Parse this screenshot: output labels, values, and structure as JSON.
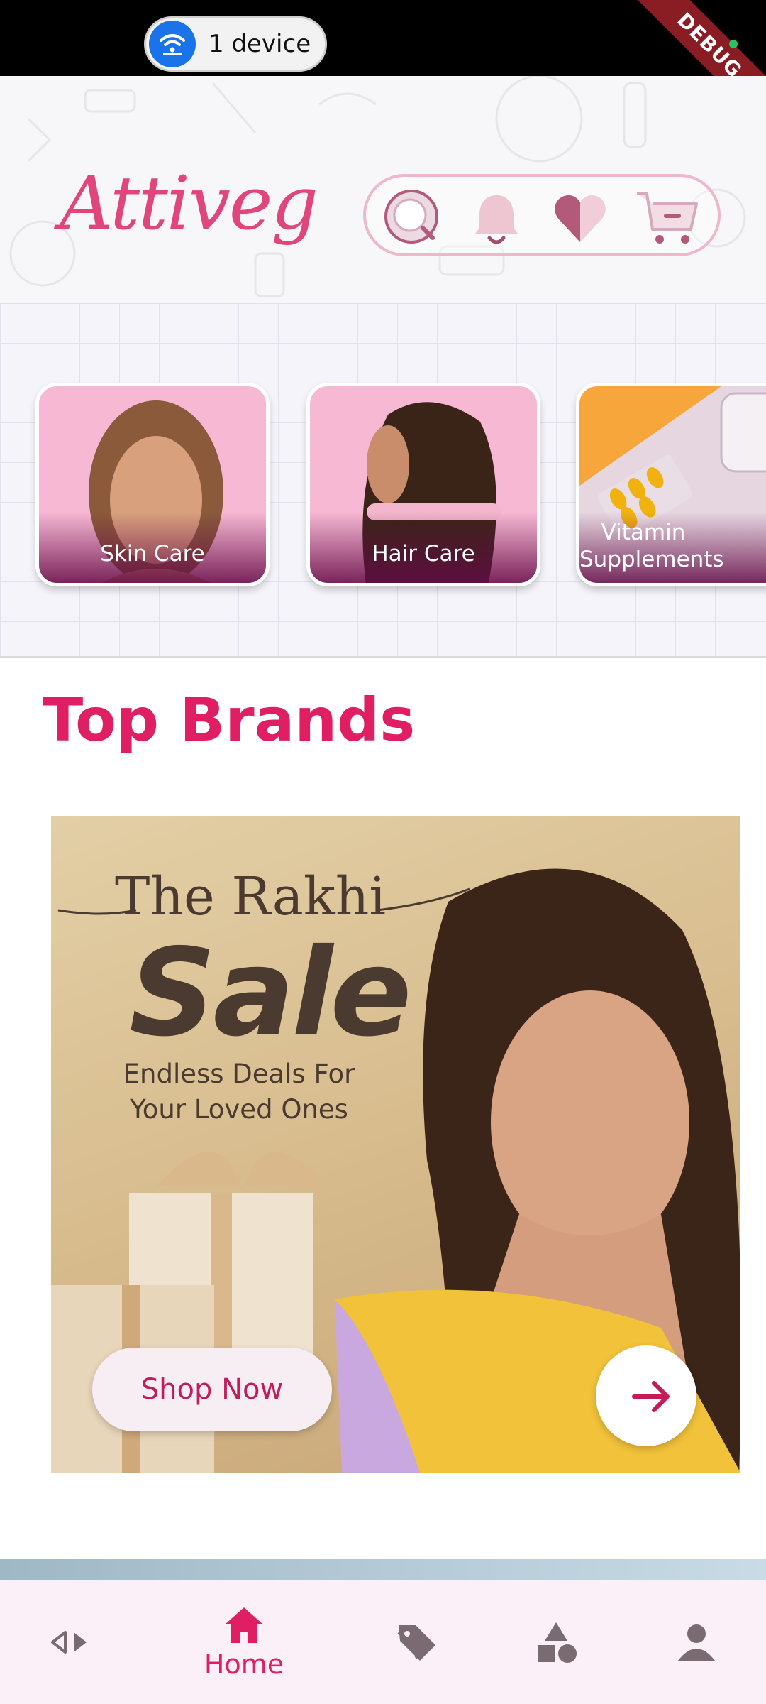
{
  "status_bar": {
    "device_label": "1 device",
    "debug_label": "DEBUG"
  },
  "header": {
    "logo": "Attiveg",
    "actions": [
      "search-icon",
      "bell-icon",
      "heart-icon",
      "cart-icon"
    ]
  },
  "categories": [
    {
      "label": "Skin Care"
    },
    {
      "label": "Hair Care"
    },
    {
      "label": "Vitamin Supplements"
    }
  ],
  "top_brands": {
    "title": "Top Brands",
    "banner": {
      "headline": "The Rakhi",
      "headline_big": "Sale",
      "subtitle": "Endless Deals For Your Loved Ones",
      "cta": "Shop Now"
    }
  },
  "bottom_nav": {
    "items": [
      {
        "icon": "code-icon",
        "label": ""
      },
      {
        "icon": "home-icon",
        "label": "Home",
        "active": true
      },
      {
        "icon": "tag-icon",
        "label": ""
      },
      {
        "icon": "shapes-icon",
        "label": ""
      },
      {
        "icon": "person-icon",
        "label": ""
      }
    ]
  },
  "colors": {
    "brand": "#e01e63",
    "logo": "#e0457b",
    "nav_background": "#fbf0f8"
  }
}
